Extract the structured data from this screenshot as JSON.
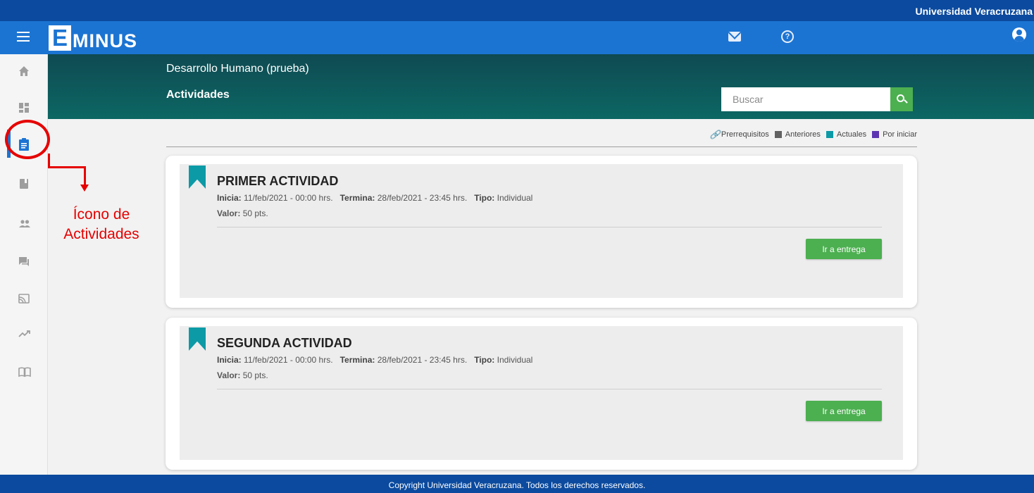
{
  "top_bar": {
    "institution": "Universidad Veracruzana"
  },
  "header": {
    "logo_letter": "E",
    "logo_rest": "MINUS"
  },
  "course": {
    "name": "Desarrollo Humano (prueba)",
    "section": "Actividades",
    "search_placeholder": "Buscar"
  },
  "legend": {
    "items": [
      {
        "label": "Prerrequisitos",
        "icon": "link-icon"
      },
      {
        "label": "Anteriores",
        "color": "#616161"
      },
      {
        "label": "Actuales",
        "color": "#0c9aa6"
      },
      {
        "label": "Por iniciar",
        "color": "#5e35b1"
      }
    ]
  },
  "sidebar": {
    "items": [
      {
        "icon": "home-icon"
      },
      {
        "icon": "dashboard-icon"
      },
      {
        "icon": "assignment-icon",
        "active": true
      },
      {
        "icon": "book-icon"
      },
      {
        "icon": "people-icon"
      },
      {
        "icon": "forum-icon"
      },
      {
        "icon": "cast-icon"
      },
      {
        "icon": "trending-icon"
      },
      {
        "icon": "open-book-icon"
      }
    ]
  },
  "labels": {
    "start": "Inicia:",
    "end": "Termina:",
    "type": "Tipo:",
    "value": "Valor:"
  },
  "activities": [
    {
      "title": "PRIMER ACTIVIDAD",
      "start": "11/feb/2021 - 00:00 hrs.",
      "end": "28/feb/2021 - 23:45 hrs.",
      "type": "Individual",
      "value": "50 pts.",
      "button": "Ir a entrega"
    },
    {
      "title": "SEGUNDA ACTIVIDAD",
      "start": "11/feb/2021 - 00:00 hrs.",
      "end": "28/feb/2021 - 23:45 hrs.",
      "type": "Individual",
      "value": "50 pts.",
      "button": "Ir a entrega"
    }
  ],
  "annotation": {
    "line1": "Ícono de",
    "line2": "Actividades",
    "color": "#e60000"
  },
  "footer": {
    "text": "Copyright Universidad Veracruzana. Todos los derechos reservados."
  },
  "colors": {
    "top_bar": "#0b4a9e",
    "header": "#1c74d2",
    "accent_green": "#4caf50",
    "band": "#0c6763"
  }
}
